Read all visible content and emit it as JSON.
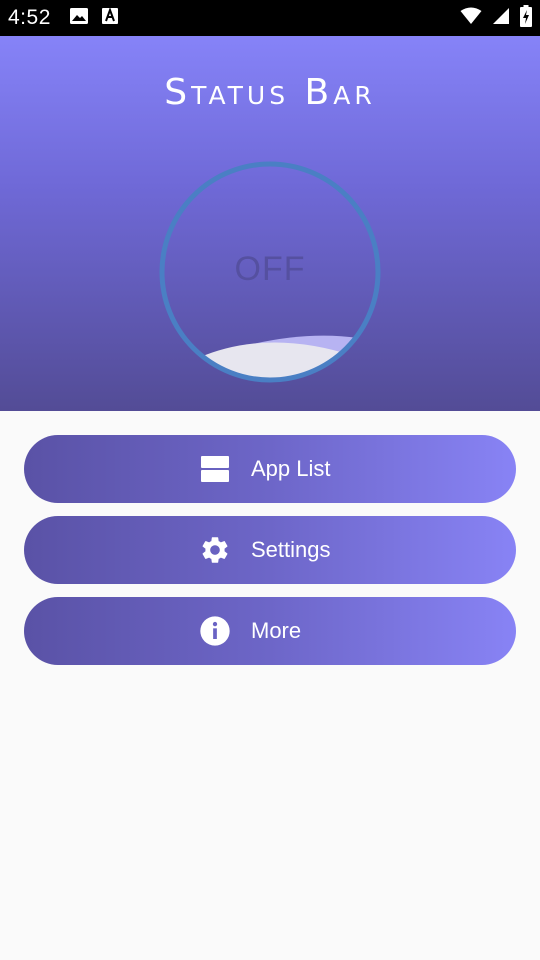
{
  "status_bar": {
    "time": "4:52",
    "left_icons": [
      "image-icon",
      "a-icon"
    ],
    "right_icons": [
      "wifi-icon",
      "signal-icon",
      "battery-charging-icon"
    ]
  },
  "header": {
    "title": "Status Bar",
    "toggle_state": "OFF",
    "colors": {
      "top": "#8683f8",
      "bottom": "#534c96",
      "ring": "#4a7fc4"
    }
  },
  "menu": {
    "items": [
      {
        "label": "App List",
        "icon": "app-list-icon"
      },
      {
        "label": "Settings",
        "icon": "gear-icon"
      },
      {
        "label": "More",
        "icon": "info-icon"
      }
    ]
  }
}
